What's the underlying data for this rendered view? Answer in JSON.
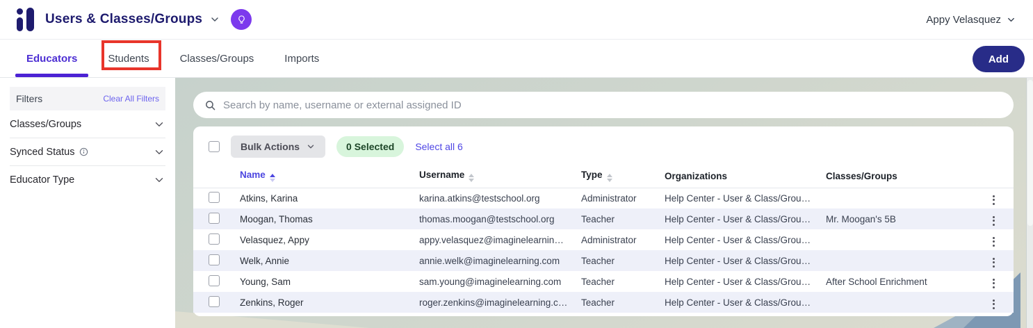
{
  "header": {
    "title": "Users & Classes/Groups",
    "user_menu_label": "Appy Velasquez"
  },
  "tabs": [
    {
      "label": "Educators",
      "active": true
    },
    {
      "label": "Students",
      "active": false,
      "annotated": true
    },
    {
      "label": "Classes/Groups",
      "active": false
    },
    {
      "label": "Imports",
      "active": false
    }
  ],
  "add_button_label": "Add",
  "sidebar": {
    "title": "Filters",
    "clear_label": "Clear All Filters",
    "sections": [
      {
        "label": "Classes/Groups",
        "has_info": false
      },
      {
        "label": "Synced Status",
        "has_info": true
      },
      {
        "label": "Educator Type",
        "has_info": false
      }
    ]
  },
  "search": {
    "placeholder": "Search by name, username or external assigned ID"
  },
  "toolbar": {
    "bulk_actions_label": "Bulk Actions",
    "selected_badge": "0 Selected",
    "select_all_label": "Select all 6"
  },
  "table": {
    "columns": [
      {
        "label": "Name",
        "sorted": "asc"
      },
      {
        "label": "Username",
        "sortable": true
      },
      {
        "label": "Type",
        "sortable": true
      },
      {
        "label": "Organizations"
      },
      {
        "label": "Classes/Groups"
      }
    ],
    "rows": [
      {
        "name": "Atkins, Karina",
        "username": "karina.atkins@testschool.org",
        "type": "Administrator",
        "organizations": "Help Center - User & Class/Group ...",
        "classes_groups": ""
      },
      {
        "name": "Moogan, Thomas",
        "username": "thomas.moogan@testschool.org",
        "type": "Teacher",
        "organizations": "Help Center - User & Class/Group ...",
        "classes_groups": "Mr. Moogan's 5B"
      },
      {
        "name": "Velasquez, Appy",
        "username": "appy.velasquez@imaginelearning....",
        "type": "Administrator",
        "organizations": "Help Center - User & Class/Group ...",
        "classes_groups": ""
      },
      {
        "name": "Welk, Annie",
        "username": "annie.welk@imaginelearning.com",
        "type": "Teacher",
        "organizations": "Help Center - User & Class/Group ...",
        "classes_groups": ""
      },
      {
        "name": "Young, Sam",
        "username": "sam.young@imaginelearning.com",
        "type": "Teacher",
        "organizations": "Help Center - User & Class/Group ...",
        "classes_groups": "After School Enrichment"
      },
      {
        "name": "Zenkins, Roger",
        "username": "roger.zenkins@imaginelearning.com",
        "type": "Teacher",
        "organizations": "Help Center - User & Class/Group ...",
        "classes_groups": ""
      }
    ]
  },
  "icons": {
    "logo": "imagine-learning-mark",
    "help_badge": "lightbulb-icon",
    "search": "magnifier-icon",
    "info": "info-circle-icon",
    "chevron": "chevron-down-icon",
    "row_menu": "kebab-menu-icon"
  },
  "colors": {
    "brand_navy": "#1e1b6e",
    "accent_purple": "#4c22d4",
    "badge_violet": "#7c3aed",
    "add_button": "#282c88",
    "link": "#4f46e5",
    "selected_badge_bg": "#d8f5dc",
    "selected_badge_text": "#1c4527",
    "row_alt": "#eef0f9",
    "annotation_red": "#e8352b",
    "main_bg_green": "#cdd6ce",
    "mountain_blue": "#7d98b3"
  }
}
